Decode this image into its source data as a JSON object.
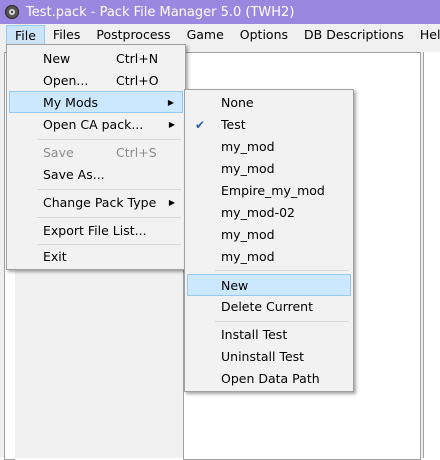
{
  "window": {
    "title": "Test.pack - Pack File Manager 5.0 (TWH2)"
  },
  "menubar": {
    "items": [
      "File",
      "Files",
      "Postprocess",
      "Game",
      "Options",
      "DB Descriptions",
      "Help"
    ]
  },
  "file_menu": {
    "new": "New",
    "new_shortcut": "Ctrl+N",
    "open": "Open...",
    "open_shortcut": "Ctrl+O",
    "my_mods": "My Mods",
    "open_ca_pack": "Open CA pack...",
    "save": "Save",
    "save_shortcut": "Ctrl+S",
    "save_as": "Save As...",
    "change_pack_type": "Change Pack Type",
    "export_file_list": "Export File List...",
    "exit": "Exit"
  },
  "my_mods_menu": {
    "mods": [
      "None",
      "Test",
      "my_mod",
      "my_mod",
      "Empire_my_mod",
      "my_mod-02",
      "my_mod",
      "my_mod"
    ],
    "checked_index": 1,
    "new": "New",
    "delete_current": "Delete Current",
    "install_test": "Install Test",
    "uninstall_test": "Uninstall Test",
    "open_data_path": "Open Data Path"
  },
  "icons": {
    "app": "gear-icon",
    "submenu": "chevron-right-icon",
    "check": "checkmark-icon"
  },
  "colors": {
    "titlebar": "#9a88e0",
    "highlight": "#cce8ff",
    "highlight_border": "#99c9ef"
  }
}
